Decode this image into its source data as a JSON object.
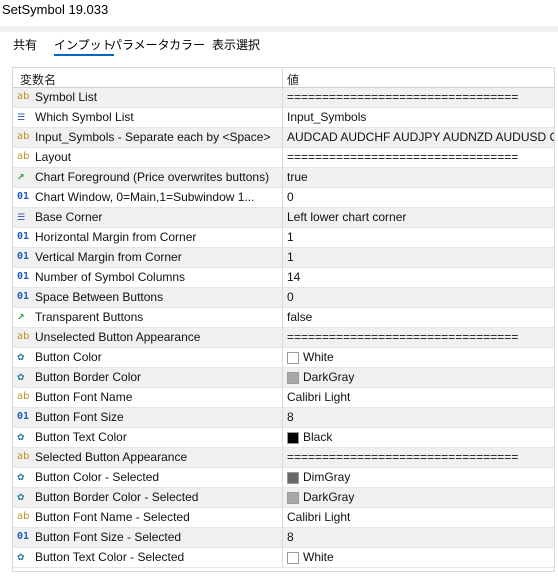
{
  "window": {
    "title": "SetSymbol 19.033"
  },
  "tabs": [
    {
      "label": "共有"
    },
    {
      "label": "インプット"
    },
    {
      "label": "パラメータ"
    },
    {
      "label": "カラー"
    },
    {
      "label": "表示選択"
    }
  ],
  "active_tab": "インプット",
  "table": {
    "headers": {
      "name": "変数名",
      "value": "値"
    },
    "rows": [
      {
        "icon": "ab",
        "name": "Symbol List",
        "value": "================================="
      },
      {
        "icon": "list",
        "name": "Which Symbol List",
        "value": "Input_Symbols"
      },
      {
        "icon": "ab",
        "name": "Input_Symbols - Separate each by <Space>",
        "value": "AUDCAD AUDCHF AUDJPY AUDNZD AUDUSD C..."
      },
      {
        "icon": "ab",
        "name": "Layout",
        "value": "================================="
      },
      {
        "icon": "bool",
        "name": "Chart Foreground (Price overwrites buttons)",
        "value": "true"
      },
      {
        "icon": "01",
        "name": "Chart Window, 0=Main,1=Subwindow 1...",
        "value": "0"
      },
      {
        "icon": "list",
        "name": "Base Corner",
        "value": "Left lower chart corner"
      },
      {
        "icon": "01",
        "name": "Horizontal Margin from Corner",
        "value": "1"
      },
      {
        "icon": "01",
        "name": "Vertical Margin from Corner",
        "value": "1"
      },
      {
        "icon": "01",
        "name": "Number of Symbol Columns",
        "value": "14"
      },
      {
        "icon": "01",
        "name": "Space Between Buttons",
        "value": "0"
      },
      {
        "icon": "bool",
        "name": "Transparent Buttons",
        "value": "false"
      },
      {
        "icon": "ab",
        "name": "Unselected Button Appearance",
        "value": "================================="
      },
      {
        "icon": "color",
        "name": "Button Color",
        "value": "White",
        "swatch": "#ffffff"
      },
      {
        "icon": "color",
        "name": "Button Border Color",
        "value": "DarkGray",
        "swatch": "#a9a9a9"
      },
      {
        "icon": "ab",
        "name": "Button Font Name",
        "value": "Calibri Light"
      },
      {
        "icon": "01",
        "name": "Button Font Size",
        "value": "8"
      },
      {
        "icon": "color",
        "name": "Button Text Color",
        "value": "Black",
        "swatch": "#000000"
      },
      {
        "icon": "ab",
        "name": "Selected Button Appearance",
        "value": "================================="
      },
      {
        "icon": "color",
        "name": "Button Color - Selected",
        "value": "DimGray",
        "swatch": "#696969"
      },
      {
        "icon": "color",
        "name": "Button Border Color - Selected",
        "value": "DarkGray",
        "swatch": "#a9a9a9"
      },
      {
        "icon": "ab",
        "name": "Button Font Name - Selected",
        "value": "Calibri Light"
      },
      {
        "icon": "01",
        "name": "Button Font Size - Selected",
        "value": "8"
      },
      {
        "icon": "color",
        "name": "Button Text Color - Selected",
        "value": "White",
        "swatch": "#ffffff"
      }
    ]
  },
  "colors": {
    "accent": "#0067c0",
    "row_alt": "#f0f0f0",
    "grid": "#d9d9d9"
  }
}
